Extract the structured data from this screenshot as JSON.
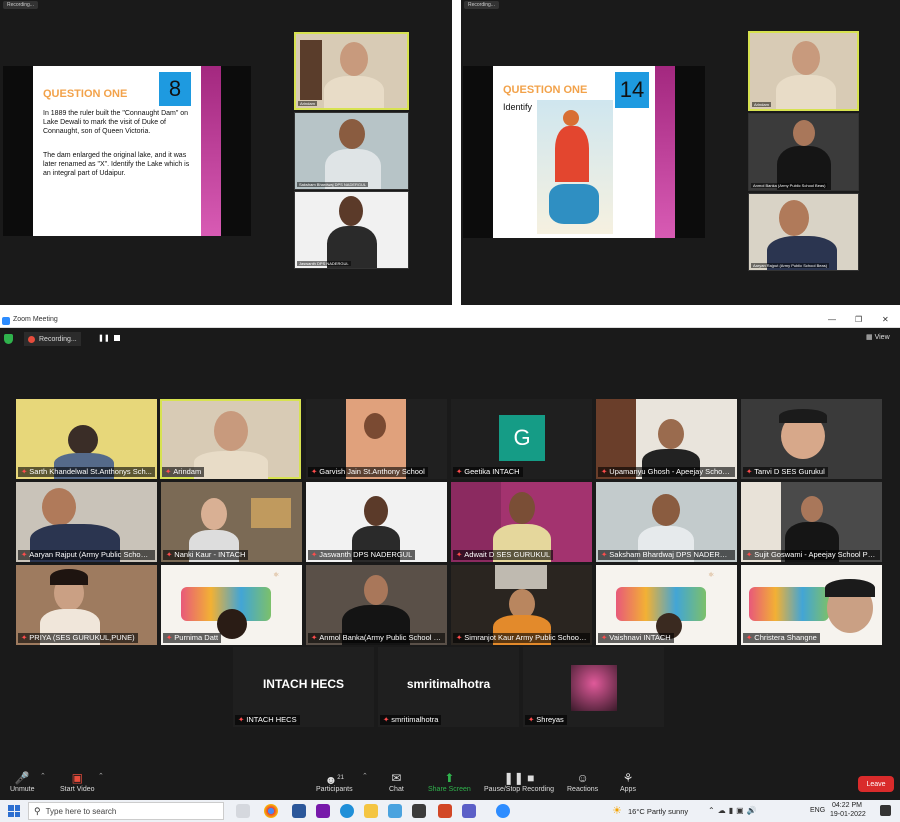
{
  "top_left": {
    "recording": "Recording...",
    "slide": {
      "title": "QUESTION ONE",
      "number": "8",
      "para1": "In 1889 the ruler built the \"Connaught Dam\" on Lake Dewali to mark the visit of Duke of Connaught, son of Queen Victoria.",
      "para2": "The dam enlarged the original lake, and it was later renamed as \"X\". Identify the Lake which is an integral part of Udaipur."
    },
    "thumbs": [
      "Arindam",
      "Saksham Bhardwaj DPS NADERGUL",
      "Jaswanth DPS NADERGUL"
    ]
  },
  "top_right": {
    "recording": "Recording...",
    "slide": {
      "title": "QUESTION ONE",
      "number": "14",
      "text": "Identify"
    },
    "thumbs": [
      "Arindam",
      "Anmol Banka (Army Public School Beas)",
      "Aaryan Rajput (Army Public School Beas)"
    ]
  },
  "window": {
    "title": "Zoom Meeting",
    "recording": "Recording...",
    "view": "View"
  },
  "tiles": [
    {
      "name": "Sarth Khandelwal St.Anthonys Sch..."
    },
    {
      "name": "Arindam"
    },
    {
      "name": "Garvish Jain St.Anthony School"
    },
    {
      "name": "Geetika  INTACH",
      "initial": "G"
    },
    {
      "name": "Upamanyu Ghosh - Apeejay School P..."
    },
    {
      "name": "Tanvi D SES Gurukul"
    },
    {
      "name": "Aaryan Rajput (Army Public School B..."
    },
    {
      "name": "Nanki Kaur - INTACH"
    },
    {
      "name": "Jaswanth DPS NADERGUL"
    },
    {
      "name": "Adwait D SES GURUKUL"
    },
    {
      "name": "Saksham Bhardwaj DPS NADERGUL"
    },
    {
      "name": "Sujit Goswami - Apeejay School Park ..."
    },
    {
      "name": "PRIYA (SES GURUKUL,PUNE)"
    },
    {
      "name": "Purnima Datt"
    },
    {
      "name": "Anmol Banka(Army Public School Be..."
    },
    {
      "name": "Simranjot Kaur Army Public School Beas..."
    },
    {
      "name": "Vaishnavi INTACH"
    },
    {
      "name": "Christera Shangne"
    },
    {
      "name": "INTACH HECS",
      "big": "INTACH HECS"
    },
    {
      "name": "smritimalhotra",
      "big": "smritimalhotra"
    },
    {
      "name": "Shreyas"
    }
  ],
  "toolbar": {
    "unmute": "Unmute",
    "start_video": "Start Video",
    "participants": "Participants",
    "participants_count": "21",
    "chat": "Chat",
    "share": "Share Screen",
    "record": "Pause/Stop Recording",
    "reactions": "Reactions",
    "apps": "Apps",
    "leave": "Leave"
  },
  "taskbar": {
    "search_placeholder": "Type here to search",
    "weather": "16°C  Partly sunny",
    "lang": "ENG",
    "time": "04:22 PM",
    "date": "19-01-2022"
  },
  "colors": {
    "accent_green": "#2fb24c",
    "leave_red": "#d92b2b",
    "active_yellow": "#d7e250"
  }
}
